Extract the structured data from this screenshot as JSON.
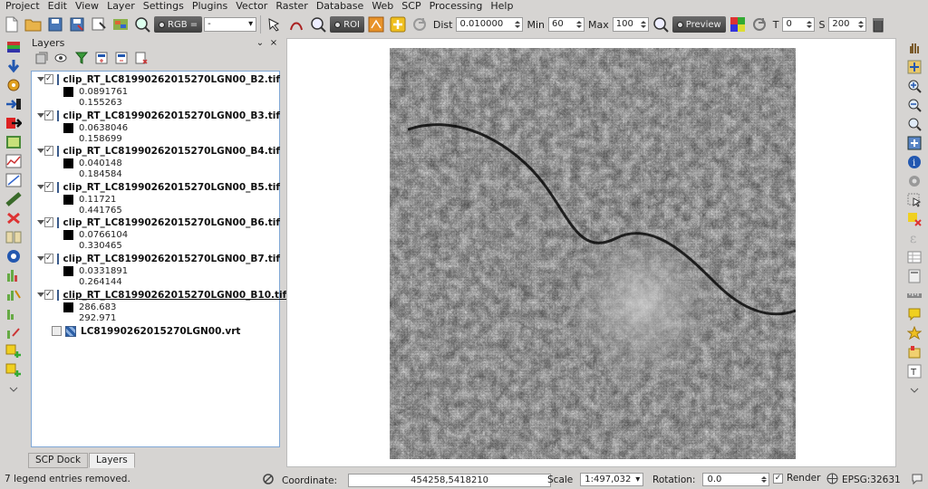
{
  "menubar": {
    "items": [
      "Project",
      "Edit",
      "View",
      "Layer",
      "Settings",
      "Plugins",
      "Vector",
      "Raster",
      "Database",
      "Web",
      "SCP",
      "Processing",
      "Help"
    ]
  },
  "toolbar": {
    "rgb_label": "RGB =",
    "rgb_value": "-",
    "roi_label": "ROI",
    "dist_label": "Dist",
    "dist_value": "0.010000",
    "min_label": "Min",
    "min_value": "60",
    "max_label": "Max",
    "max_value": "100",
    "preview_label": "Preview",
    "t_label": "T",
    "t_value": "0",
    "s_label": "S",
    "s_value": "200"
  },
  "layers_panel": {
    "title": "Layers",
    "float_ctrl": "⌄",
    "close_ctrl": "×",
    "layers": [
      {
        "name": "clip_RT_LC81990262015270LGN00_B2.tif",
        "min": "0.0891761",
        "max": "0.155263",
        "checked": true
      },
      {
        "name": "clip_RT_LC81990262015270LGN00_B3.tif",
        "min": "0.0638046",
        "max": "0.158699",
        "checked": true
      },
      {
        "name": "clip_RT_LC81990262015270LGN00_B4.tif",
        "min": "0.040148",
        "max": "0.184584",
        "checked": true
      },
      {
        "name": "clip_RT_LC81990262015270LGN00_B5.tif",
        "min": "0.11721",
        "max": "0.441765",
        "checked": true
      },
      {
        "name": "clip_RT_LC81990262015270LGN00_B6.tif",
        "min": "0.0766104",
        "max": "0.330465",
        "checked": true
      },
      {
        "name": "clip_RT_LC81990262015270LGN00_B7.tif",
        "min": "0.0331891",
        "max": "0.264144",
        "checked": true
      },
      {
        "name": "clip_RT_LC81990262015270LGN00_B10.tif",
        "min": "286.683",
        "max": "292.971",
        "checked": true
      }
    ],
    "vrt_layer": {
      "name": "LC81990262015270LGN00.vrt",
      "checked": false
    }
  },
  "panel_tabs": [
    "SCP Dock",
    "Layers"
  ],
  "statusbar": {
    "message": "7 legend entries removed.",
    "coordinate_label": "Coordinate:",
    "coordinate_value": "454258,5418210",
    "scale_label": "Scale",
    "scale_value": "1:497,032",
    "rotation_label": "Rotation:",
    "rotation_value": "0.0",
    "render_label": "Render",
    "crs_label": "EPSG:32631"
  },
  "colors": {
    "accent_blue": "#2b5fa6",
    "panel_bg": "#d6d4d2"
  }
}
